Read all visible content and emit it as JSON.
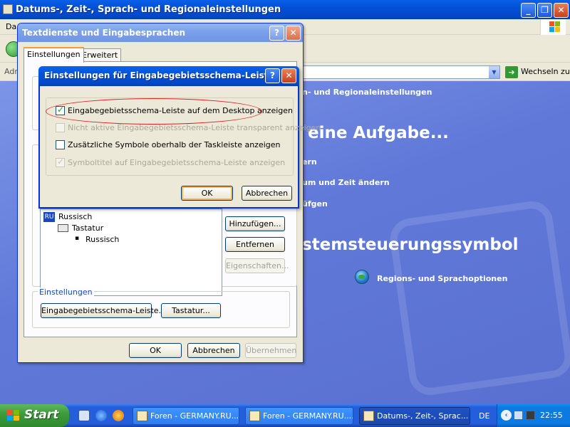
{
  "main_window": {
    "title": "Datums-, Zeit-, Sprach- und Regionaleinstellungen",
    "menu_stub": "Da",
    "address_label": "Adr",
    "go_label": "Wechseln zu",
    "content": {
      "header": "n- und Regionaleinstellungen",
      "task_heading": "eine Aufgabe...",
      "task1": "ern",
      "task2": "um und Zeit ändern",
      "task3": "üfgen",
      "cp_heading": "stemsteuerungssymbol",
      "cp_item": "Regions- und Sprachoptionen"
    }
  },
  "text_services": {
    "title": "Textdienste und Eingabesprachen",
    "tabs": [
      "Einstellungen",
      "Erweitert"
    ],
    "lang_badge": "RU",
    "tree": {
      "language": "Russisch",
      "category": "Tastatur",
      "layout": "Russisch"
    },
    "buttons": {
      "add": "Hinzufügen...",
      "remove": "Entfernen",
      "properties": "Eigenschaften..."
    },
    "settings_group": "Einstellungen",
    "settings_buttons": {
      "language_bar": "Eingabegebietsschema-Leiste...",
      "keyboard": "Tastatur..."
    },
    "footer": {
      "ok": "OK",
      "cancel": "Abbrechen",
      "apply": "Übernehmen"
    }
  },
  "language_bar_dialog": {
    "title": "Einstellungen für Eingabegebietsschema-Leiste",
    "options": [
      {
        "label": "Eingabegebietsschema-Leiste auf dem Desktop anzeigen",
        "checked": true,
        "enabled": true
      },
      {
        "label": "Nicht aktive Eingabegebietsschema-Leiste transparent anzeigen",
        "checked": false,
        "enabled": false
      },
      {
        "label": "Zusätzliche Symbole oberhalb der Taskleiste anzeigen",
        "checked": false,
        "enabled": true
      },
      {
        "label": "Symboltitel auf Eingabegebietsschema-Leiste anzeigen",
        "checked": true,
        "enabled": false
      }
    ],
    "ok": "OK",
    "cancel": "Abbrechen"
  },
  "window_controls": {
    "help": "?",
    "close": "✕",
    "minimize": "_",
    "maximize": "❐"
  },
  "taskbar": {
    "start": "Start",
    "tasks": [
      "Foren - GERMANY.RU....",
      "Foren - GERMANY.RU....",
      "Datums-, Zeit-, Sprac..."
    ],
    "language": "DE",
    "clock": "22:55"
  }
}
